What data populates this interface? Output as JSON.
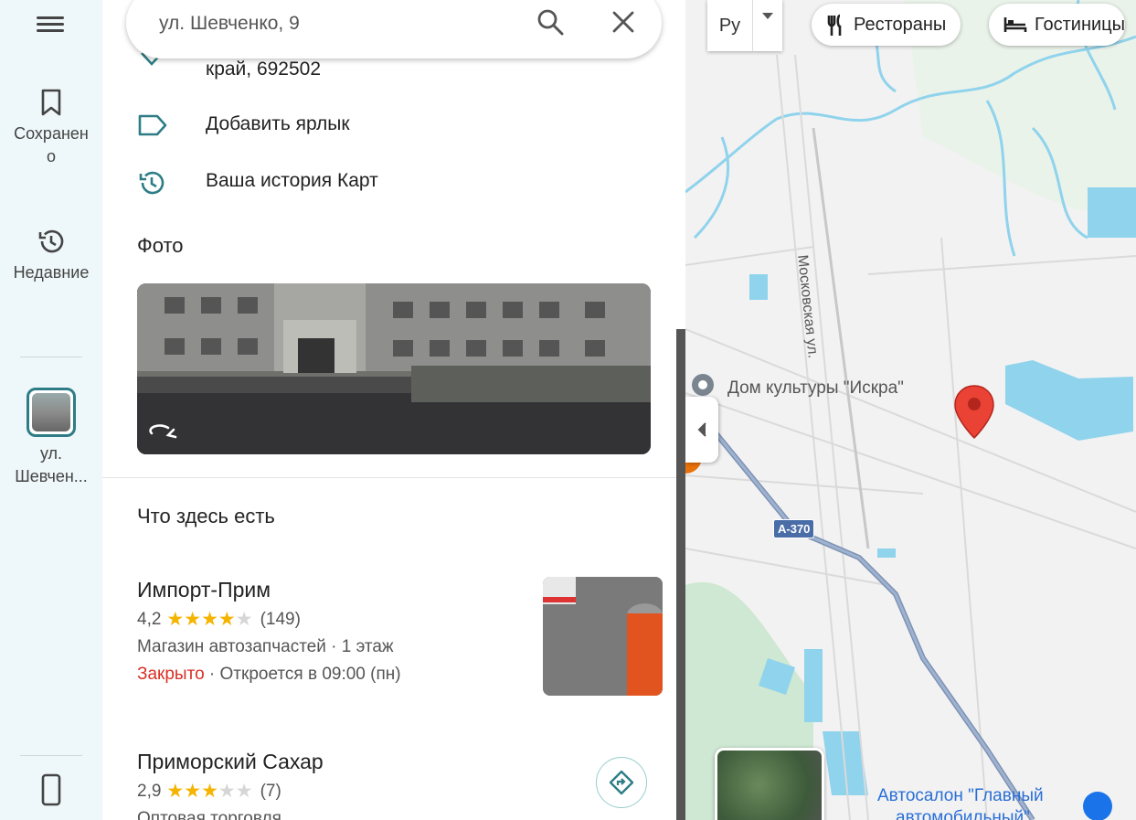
{
  "rail": {
    "saved_label": "Сохранено",
    "recent_label": "Недавние",
    "current_label": "ул. Шевчен..."
  },
  "search": {
    "value": "ул. Шевченко, 9"
  },
  "details": {
    "address_tail": "край, 692502",
    "add_label": "Добавить ярлык",
    "history": "Ваша история Карт"
  },
  "photos": {
    "title": "Фото"
  },
  "nearby": {
    "title": "Что здесь есть",
    "places": [
      {
        "name": "Импорт-Прим",
        "rating": "4,2",
        "stars": 4,
        "reviews": "(149)",
        "category": "Магазин автозапчастей · 1 этаж",
        "status_closed": "Закрыто",
        "status_rest": " · Откроется в 09:00 (пн)"
      },
      {
        "name": "Приморский Сахар",
        "rating": "2,9",
        "stars": 3,
        "reviews": "(7)",
        "category": "Оптовая торговля"
      }
    ]
  },
  "map": {
    "lang": "Ру",
    "chips": {
      "restaurants": "Рестораны",
      "hotels": "Гостиницы"
    },
    "labels": {
      "dk": "Дом культуры \"Искра\"",
      "street": "Московская ул.",
      "highway": "А-370",
      "autosalon": "Автосалон \"Главный",
      "autosalon2": "автомобильный\""
    }
  },
  "colors": {
    "accent": "#1a73e8",
    "rail_bg": "#eef7f9",
    "teal": "#2e7d86",
    "pin": "#ea4335",
    "star": "#f4b400",
    "closed": "#d93025"
  }
}
